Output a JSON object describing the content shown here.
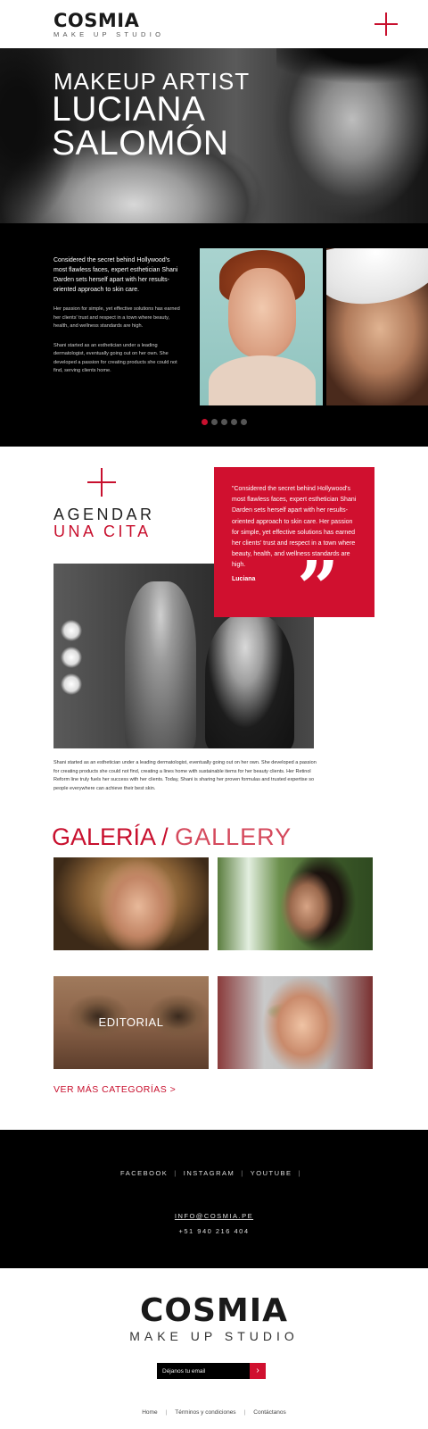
{
  "header": {
    "logo_word": "COSMIA",
    "logo_sub": "MAKE UP STUDIO",
    "menu_icon": "plus-cross-icon"
  },
  "hero": {
    "kicker": "MAKEUP ARTIST",
    "name_line1": "LUCIANA",
    "name_line2": "SALOMÓN"
  },
  "about": {
    "p1": "Considered the secret behind Hollywood's most flawless faces, expert esthetician Shani Darden sets herself apart with her results-oriented approach to skin care.",
    "p2": "Her passion for simple, yet effective solutions has earned her clients' trust and respect in a town where beauty, health, and wellness standards are high.",
    "p3": "Shani started as an esthetician under a leading dermatologist, eventually going out on her own. She developed a passion for creating products she could not find, serving clients home.",
    "carousel_dots": 5,
    "active_dot": 0
  },
  "booking": {
    "title_line1": "AGENDAR",
    "title_line2": "UNA CITA",
    "quote": "\"Considered the secret behind Hollywood's most flawless faces, expert esthetician Shani Darden sets herself apart with her results-oriented approach to skin care. Her passion for simple, yet effective solutions has earned her clients' trust and respect in a town where beauty, health, and wellness standards are high.",
    "quote_author": "Luciana",
    "quote_mark": "”",
    "caption": "Shani started as an esthetician under a leading dermatologist, eventually going out on her own. She developed a passion for creating products she could not find, creating a lines home with sustainable items for her beauty clients. Her Retinol Reform line truly fuels her success with her clients. Today, Shani is sharing her proven formulas and trusted expertise so people everywhere can achieve their best skin."
  },
  "gallery": {
    "title_es": "GALERÍA",
    "title_slash": "/",
    "title_en": "GALLERY",
    "tiles": [
      {
        "label": ""
      },
      {
        "label": ""
      },
      {
        "label": "EDITORIAL"
      },
      {
        "label": ""
      }
    ],
    "more_link": "VER MÁS CATEGORÍAS >"
  },
  "contact": {
    "social": [
      "FACEBOOK",
      "INSTAGRAM",
      "YOUTUBE"
    ],
    "separator": "|",
    "email": "INFO@COSMIA.PE",
    "phone": "+51 940 216 404"
  },
  "footer": {
    "logo_word": "COSMIA",
    "logo_sub": "MAKE UP STUDIO",
    "newsletter_placeholder": "Déjanos tu email",
    "newsletter_button": "›",
    "nav": [
      "Home",
      "Términos y condiciones",
      "Contáctanos"
    ],
    "nav_separator": "|"
  },
  "colors": {
    "accent": "#c8102e",
    "black": "#000000",
    "white": "#ffffff"
  }
}
